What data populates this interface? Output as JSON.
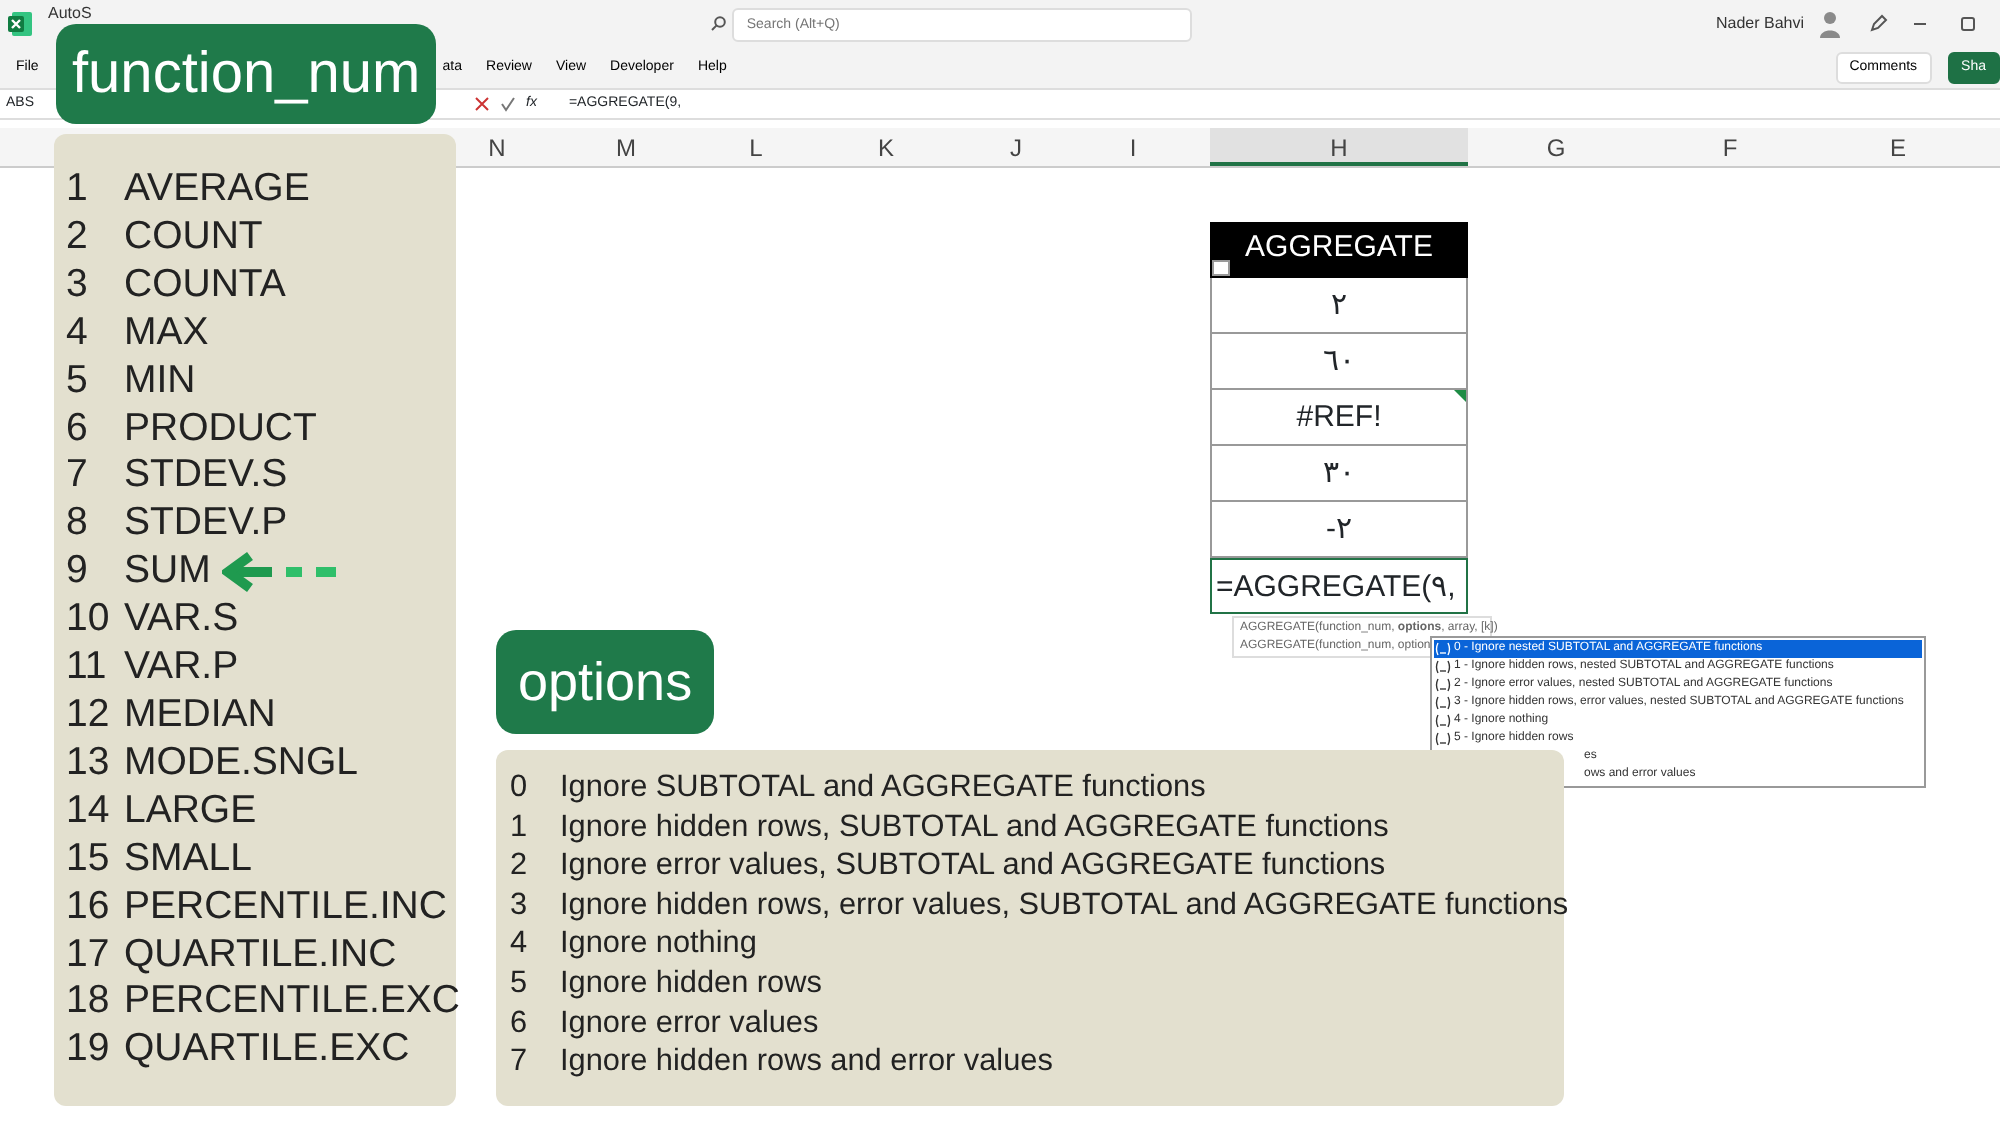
{
  "title_bar": {
    "app_name": "AutoS",
    "search": {
      "placeholder": "Search (Alt+Q)"
    },
    "user_name": "Nader Bahvi"
  },
  "ribbon_tabs": [
    {
      "label": "File"
    },
    {
      "label": "ata"
    },
    {
      "label": "Review"
    },
    {
      "label": "View"
    },
    {
      "label": "Developer"
    },
    {
      "label": "Help"
    }
  ],
  "ribbon_buttons": [
    {
      "kind": "comments",
      "label": "Comments"
    },
    {
      "kind": "share",
      "label": "Sha"
    }
  ],
  "formula_bar": {
    "name_box": "ABS",
    "formula": "=AGGREGATE(9,",
    "function_label": "fx"
  },
  "column_headers": [
    {
      "label": "N",
      "selected": false
    },
    {
      "label": "M",
      "selected": false
    },
    {
      "label": "L",
      "selected": false
    },
    {
      "label": "K",
      "selected": false
    },
    {
      "label": "J",
      "selected": false
    },
    {
      "label": "I",
      "selected": false
    },
    {
      "label": "H",
      "selected": true
    },
    {
      "label": "G",
      "selected": false
    },
    {
      "label": "F",
      "selected": false
    },
    {
      "label": "E",
      "selected": false
    }
  ],
  "table": {
    "header": "AGGREGATE",
    "cells": [
      {
        "value": "٢",
        "error_flag": false
      },
      {
        "value": "٦٠",
        "error_flag": false
      },
      {
        "value": "#REF!",
        "error_flag": true
      },
      {
        "value": "٣٠",
        "error_flag": false
      },
      {
        "value": "-٢",
        "error_flag": false
      }
    ],
    "editing_cell": "=AGGREGATE(٩,"
  },
  "tooltip": {
    "lines": [
      "AGGREGATE(function_num, **options**, array, [k])",
      "AGGREGATE(function_num, option"
    ]
  },
  "dropdown": {
    "items": [
      {
        "label": "0 - Ignore nested SUBTOTAL and AGGREGATE functions",
        "selected": true,
        "covered": false
      },
      {
        "label": "1 - Ignore hidden rows, nested SUBTOTAL and AGGREGATE functions",
        "selected": false,
        "covered": false
      },
      {
        "label": "2 - Ignore error values, nested SUBTOTAL and AGGREGATE functions",
        "selected": false,
        "covered": false
      },
      {
        "label": "3 - Ignore hidden rows, error values, nested SUBTOTAL and AGGREGATE functions",
        "selected": false,
        "covered": false
      },
      {
        "label": "4 - Ignore nothing",
        "selected": false,
        "covered": false
      },
      {
        "label": "5 - Ignore hidden rows",
        "selected": false,
        "covered": false
      },
      {
        "label": "es",
        "selected": false,
        "covered": true
      },
      {
        "label": "ows and error values",
        "selected": false,
        "covered": true
      }
    ]
  },
  "function_num_label": "function_num",
  "function_num_list": [
    {
      "number": "1",
      "name": "AVERAGE",
      "pointed": false
    },
    {
      "number": "2",
      "name": "COUNT",
      "pointed": false
    },
    {
      "number": "3",
      "name": "COUNTA",
      "pointed": false
    },
    {
      "number": "4",
      "name": "MAX",
      "pointed": false
    },
    {
      "number": "5",
      "name": "MIN",
      "pointed": false
    },
    {
      "number": "6",
      "name": "PRODUCT",
      "pointed": false
    },
    {
      "number": "7",
      "name": "STDEV.S",
      "pointed": false
    },
    {
      "number": "8",
      "name": "STDEV.P",
      "pointed": false
    },
    {
      "number": "9",
      "name": "SUM",
      "pointed": true
    },
    {
      "number": "10",
      "name": "VAR.S",
      "pointed": false
    },
    {
      "number": "11",
      "name": "VAR.P",
      "pointed": false
    },
    {
      "number": "12",
      "name": "MEDIAN",
      "pointed": false
    },
    {
      "number": "13",
      "name": "MODE.SNGL",
      "pointed": false
    },
    {
      "number": "14",
      "name": "LARGE",
      "pointed": false
    },
    {
      "number": "15",
      "name": "SMALL",
      "pointed": false
    },
    {
      "number": "16",
      "name": "PERCENTILE.INC",
      "pointed": false
    },
    {
      "number": "17",
      "name": "QUARTILE.INC",
      "pointed": false
    },
    {
      "number": "18",
      "name": "PERCENTILE.EXC",
      "pointed": false
    },
    {
      "number": "19",
      "name": "QUARTILE.EXC",
      "pointed": false
    }
  ],
  "options_label": "options",
  "options_list": [
    {
      "number": "0",
      "text": "Ignore SUBTOTAL and AGGREGATE functions"
    },
    {
      "number": "1",
      "text": "Ignore hidden rows, SUBTOTAL and AGGREGATE functions"
    },
    {
      "number": "2",
      "text": "Ignore error values, SUBTOTAL and AGGREGATE functions"
    },
    {
      "number": "3",
      "text": "Ignore hidden rows, error values, SUBTOTAL and AGGREGATE functions"
    },
    {
      "number": "4",
      "text": "Ignore nothing"
    },
    {
      "number": "5",
      "text": "Ignore hidden rows"
    },
    {
      "number": "6",
      "text": "Ignore error values"
    },
    {
      "number": "7",
      "text": "Ignore hidden rows and error values"
    }
  ]
}
